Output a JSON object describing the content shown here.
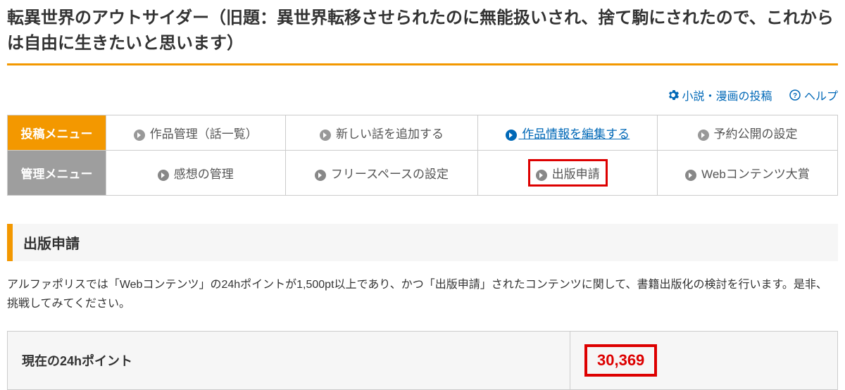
{
  "title": "転異世界のアウトサイダー（旧題：異世界転移させられたのに無能扱いされ、捨て駒にされたので、これからは自由に生きたいと思います）",
  "topLinks": {
    "post": "小説・漫画の投稿",
    "help": "ヘルプ"
  },
  "menu": {
    "postHeader": "投稿メニュー",
    "manageHeader": "管理メニュー",
    "row1": {
      "c1": "作品管理（話一覧）",
      "c2": "新しい話を追加する",
      "c3": "作品情報を編集する",
      "c4": "予約公開の設定"
    },
    "row2": {
      "c1": "感想の管理",
      "c2": "フリースペースの設定",
      "c3": "出版申請",
      "c4": "Webコンテンツ大賞"
    }
  },
  "section": {
    "header": "出版申請",
    "description": "アルファポリスでは「Webコンテンツ」の24hポイントが1,500pt以上であり、かつ「出版申請」されたコンテンツに関して、書籍出版化の検討を行います。是非、挑戦してみてください。",
    "pointsLabel": "現在の24hポイント",
    "pointsValue": "30,369"
  }
}
